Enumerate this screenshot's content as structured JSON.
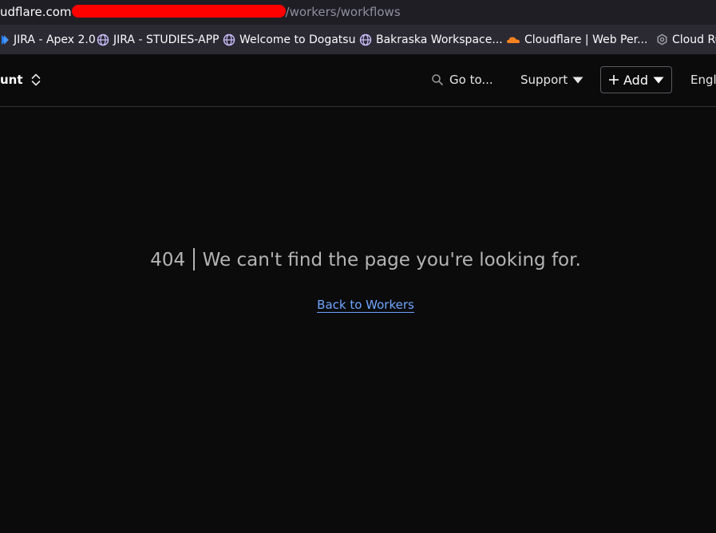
{
  "browser": {
    "url_domain": "udflare.com",
    "url_path": "/workers/workflows",
    "bookmarks": [
      {
        "label": "JIRA - Apex 2.0",
        "icon": "jira-icon"
      },
      {
        "label": "JIRA - STUDIES-APP",
        "icon": "globe-icon"
      },
      {
        "label": "Welcome to Dogatsu",
        "icon": "globe-icon"
      },
      {
        "label": "Bakraska Workspace...",
        "icon": "globe-icon"
      },
      {
        "label": "Cloudflare | Web Per...",
        "icon": "cloudflare-icon"
      },
      {
        "label": "Cloud Ru",
        "icon": "gear-icon"
      }
    ]
  },
  "header": {
    "account_label": "unt",
    "goto_label": "Go to...",
    "support_label": "Support",
    "add_label": "Add",
    "language_label": "Engl"
  },
  "main": {
    "error_code": "404",
    "error_message": "We can't find the page you're looking for.",
    "back_link": "Back to Workers"
  },
  "colors": {
    "background": "#0b0b0c",
    "link": "#6fa6ff",
    "redaction": "#ff0000"
  }
}
